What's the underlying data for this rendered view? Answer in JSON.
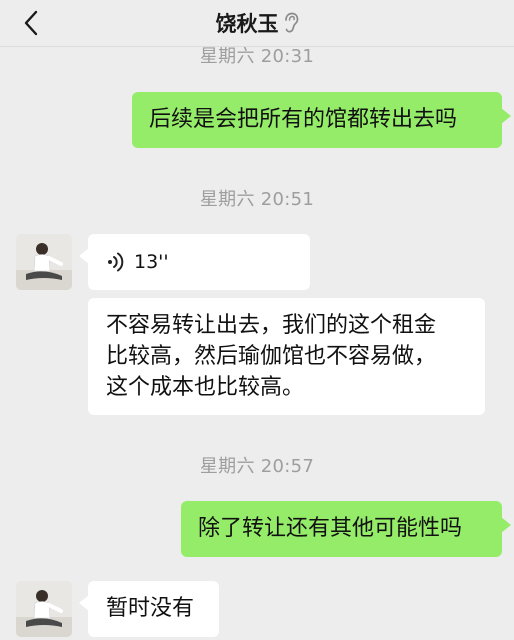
{
  "header": {
    "title": "饶秋玉",
    "back_icon": "chevron-left-icon",
    "status_icon": "ear-icon"
  },
  "messages": [
    {
      "type": "timestamp",
      "text": "星期六 20:31"
    },
    {
      "type": "text",
      "direction": "outgoing",
      "text": "后续是会把所有的馆都转出去吗"
    },
    {
      "type": "timestamp",
      "text": "星期六 20:51"
    },
    {
      "type": "voice",
      "direction": "incoming",
      "duration": "13''"
    },
    {
      "type": "text",
      "direction": "incoming",
      "lines": [
        "不容易转让出去，我们的这个租金",
        "比较高，然后瑜伽馆也不容易做，",
        "这个成本也比较高。"
      ]
    },
    {
      "type": "timestamp",
      "text": "星期六 20:57"
    },
    {
      "type": "text",
      "direction": "outgoing",
      "text": "除了转让还有其他可能性吗"
    },
    {
      "type": "text",
      "direction": "incoming",
      "text": "暂时没有"
    }
  ],
  "colors": {
    "background": "#ededed",
    "outgoing_bubble": "#95ec69",
    "incoming_bubble": "#ffffff",
    "timestamp_text": "#9e9e9e"
  }
}
